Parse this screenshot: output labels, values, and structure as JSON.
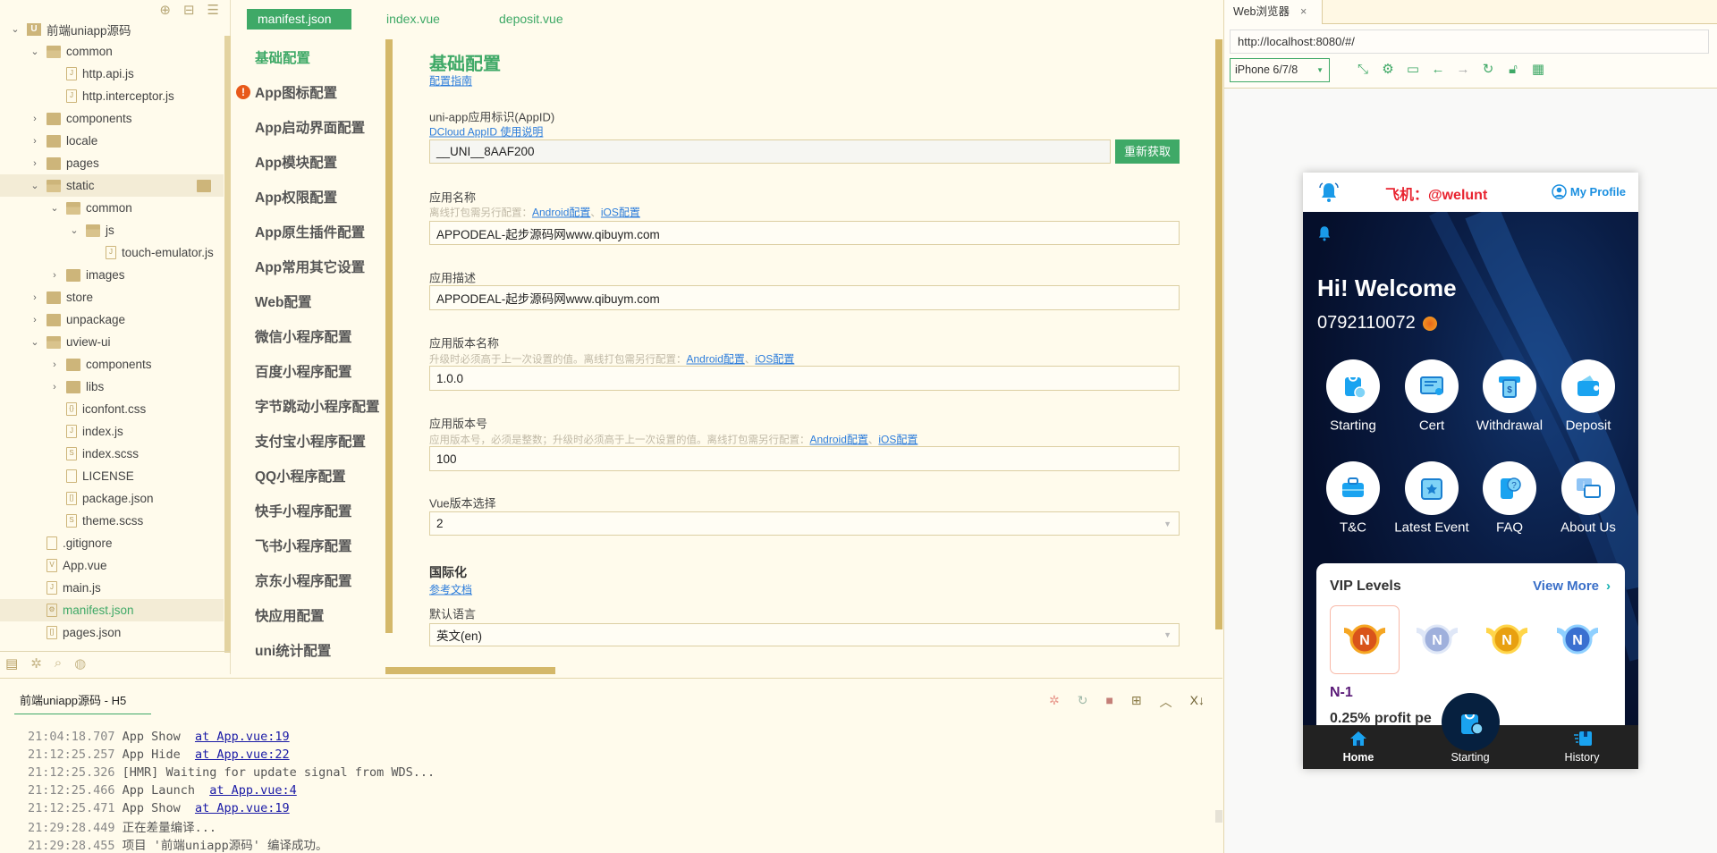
{
  "colors": {
    "accent": "#3fa967",
    "link": "#2d7ddb",
    "warning": "#e8591a",
    "phone_brand": "#1a8fe0",
    "phone_title": "#e8232f"
  },
  "tree": {
    "toolbar_icons": [
      "locate-icon",
      "collapse-icon",
      "menu-icon"
    ],
    "items": [
      {
        "label": "前端uniapp源码",
        "level": 0,
        "type": "project",
        "open": true
      },
      {
        "label": "common",
        "level": 1,
        "type": "folder",
        "open": true
      },
      {
        "label": "http.api.js",
        "level": 2,
        "type": "file",
        "glyph": "J"
      },
      {
        "label": "http.interceptor.js",
        "level": 2,
        "type": "file",
        "glyph": "J"
      },
      {
        "label": "components",
        "level": 1,
        "type": "folder",
        "open": false
      },
      {
        "label": "locale",
        "level": 1,
        "type": "folder",
        "open": false
      },
      {
        "label": "pages",
        "level": 1,
        "type": "folder",
        "open": false
      },
      {
        "label": "static",
        "level": 1,
        "type": "folder",
        "open": true,
        "highlight": true
      },
      {
        "label": "common",
        "level": 2,
        "type": "folder",
        "open": true
      },
      {
        "label": "js",
        "level": 3,
        "type": "folder",
        "open": true
      },
      {
        "label": "touch-emulator.js",
        "level": 4,
        "type": "file",
        "glyph": "J"
      },
      {
        "label": "images",
        "level": 2,
        "type": "folder",
        "open": false
      },
      {
        "label": "store",
        "level": 1,
        "type": "folder",
        "open": false
      },
      {
        "label": "unpackage",
        "level": 1,
        "type": "folder",
        "open": false
      },
      {
        "label": "uview-ui",
        "level": 1,
        "type": "folder",
        "open": true
      },
      {
        "label": "components",
        "level": 2,
        "type": "folder",
        "open": false
      },
      {
        "label": "libs",
        "level": 2,
        "type": "folder",
        "open": false
      },
      {
        "label": "iconfont.css",
        "level": 2,
        "type": "file",
        "glyph": "{}"
      },
      {
        "label": "index.js",
        "level": 2,
        "type": "file",
        "glyph": "J"
      },
      {
        "label": "index.scss",
        "level": 2,
        "type": "file",
        "glyph": "S"
      },
      {
        "label": "LICENSE",
        "level": 2,
        "type": "file",
        "glyph": ""
      },
      {
        "label": "package.json",
        "level": 2,
        "type": "file",
        "glyph": "[]"
      },
      {
        "label": "theme.scss",
        "level": 2,
        "type": "file",
        "glyph": "S"
      },
      {
        "label": ".gitignore",
        "level": 1,
        "type": "file",
        "glyph": ""
      },
      {
        "label": "App.vue",
        "level": 1,
        "type": "file",
        "glyph": "V"
      },
      {
        "label": "main.js",
        "level": 1,
        "type": "file",
        "glyph": "J"
      },
      {
        "label": "manifest.json",
        "level": 1,
        "type": "file",
        "glyph": "⚙",
        "selected": true
      },
      {
        "label": "pages.json",
        "level": 1,
        "type": "file",
        "glyph": "[]"
      }
    ],
    "bottom_tabs": [
      "project-icon",
      "debug-icon",
      "search-icon",
      "plugin-icon"
    ]
  },
  "editor_tabs": [
    {
      "label": "manifest.json",
      "active": true
    },
    {
      "label": "index.vue"
    },
    {
      "label": "deposit.vue"
    }
  ],
  "nav": {
    "items": [
      "基础配置",
      "App图标配置",
      "App启动界面配置",
      "App模块配置",
      "App权限配置",
      "App原生插件配置",
      "App常用其它设置",
      "Web配置",
      "微信小程序配置",
      "百度小程序配置",
      "字节跳动小程序配置",
      "支付宝小程序配置",
      "QQ小程序配置",
      "快手小程序配置",
      "飞书小程序配置",
      "京东小程序配置",
      "快应用配置",
      "uni统计配置"
    ],
    "active": 0,
    "warning_index": 1
  },
  "form": {
    "title": "基础配置",
    "guide_link": "配置指南",
    "appid_label": "uni-app应用标识(AppID)",
    "appid_link": "DCloud AppID 使用说明",
    "appid_value": "__UNI__8AAF200",
    "refetch_button": "重新获取",
    "name_label": "应用名称",
    "name_hint": "离线打包需另行配置：",
    "android_link": "Android配置",
    "ios_link": "iOS配置",
    "sep": "、",
    "name_value": "APPODEAL-起步源码网www.qibuym.com",
    "desc_label": "应用描述",
    "desc_value": "APPODEAL-起步源码网www.qibuym.com",
    "vername_label": "应用版本名称",
    "vername_hint": "升级时必须高于上一次设置的值。离线打包需另行配置：",
    "vername_value": "1.0.0",
    "vercode_label": "应用版本号",
    "vercode_hint": "应用版本号，必须是整数；升级时必须高于上一次设置的值。离线打包需另行配置：",
    "vercode_value": "100",
    "vue_label": "Vue版本选择",
    "vue_value": "2",
    "i18n_heading": "国际化",
    "i18n_link": "参考文档",
    "lang_label": "默认语言",
    "lang_value": "英文(en)"
  },
  "console": {
    "tab": "前端uniapp源码 - H5",
    "tools": [
      "debug-icon",
      "restart-icon",
      "stop-icon",
      "terminal-icon",
      "collapse-up-icon",
      "clear-icon"
    ],
    "lines": [
      {
        "time": "21:04:18.707",
        "msg": "App Show  ",
        "link": "at App.vue:19"
      },
      {
        "time": "21:12:25.257",
        "msg": "App Hide  ",
        "link": "at App.vue:22"
      },
      {
        "time": "21:12:25.326",
        "msg": "[HMR] Waiting for update signal from WDS...",
        "link": ""
      },
      {
        "time": "21:12:25.466",
        "msg": "App Launch  ",
        "link": "at App.vue:4"
      },
      {
        "time": "21:12:25.471",
        "msg": "App Show  ",
        "link": "at App.vue:19"
      },
      {
        "time": "21:29:28.449",
        "msg": "正在差量编译...",
        "link": ""
      },
      {
        "time": "21:29:28.455",
        "msg": "项目 '前端uniapp源码' 编译成功。",
        "link": ""
      }
    ]
  },
  "browser": {
    "tab": "Web浏览器",
    "close": "×",
    "url": "http://localhost:8080/#/",
    "device": "iPhone 6/7/8",
    "tools": [
      "open-external-icon",
      "settings-icon",
      "console-icon",
      "back-icon",
      "forward-icon",
      "reload-icon",
      "lock-icon",
      "qrcode-icon"
    ]
  },
  "phone": {
    "title": "飞机：@welunt",
    "profile": "My Profile",
    "welcome": "Hi! Welcome",
    "phone_number": "0792110072",
    "grid": [
      "Starting",
      "Cert",
      "Withdrawal",
      "Deposit",
      "T&C",
      "Latest Event",
      "FAQ",
      "About Us"
    ],
    "vip_title": "VIP Levels",
    "view_more": "View More",
    "vip_selected": "N-1",
    "vip_desc": "0.25% profit pe",
    "medal_letter": "N",
    "bottom_nav": [
      "Home",
      "Starting",
      "History"
    ]
  }
}
